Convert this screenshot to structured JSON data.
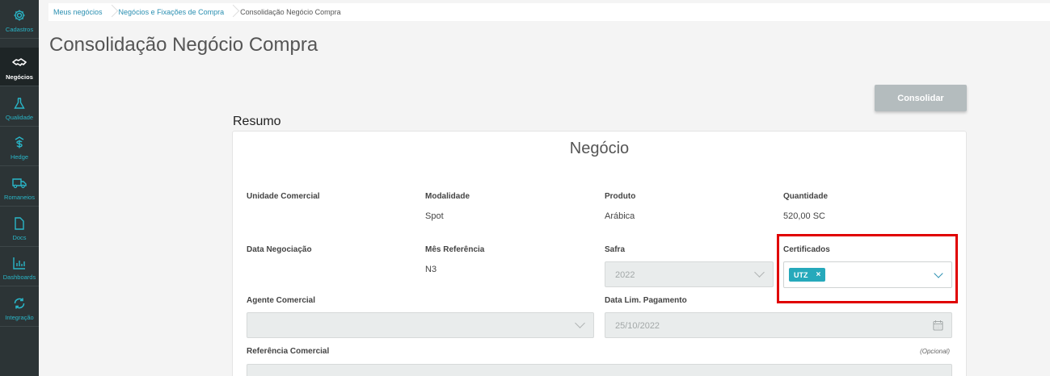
{
  "sidebar": {
    "items": [
      {
        "label": "Cadastros",
        "icon": "gear-icon"
      },
      {
        "label": "Negócios",
        "icon": "handshake-icon"
      },
      {
        "label": "Qualidade",
        "icon": "flask-icon"
      },
      {
        "label": "Hedge",
        "icon": "dollar-icon"
      },
      {
        "label": "Romaneios",
        "icon": "truck-icon"
      },
      {
        "label": "Docs",
        "icon": "document-icon"
      },
      {
        "label": "Dashboards",
        "icon": "bar-chart-icon"
      },
      {
        "label": "Integração",
        "icon": "sync-icon"
      }
    ],
    "active": "Negócios",
    "accent": "#29b6c8"
  },
  "breadcrumb": [
    "Meus negócios",
    "Negócios e Fixações de Compra",
    "Consolidação Negócio Compra"
  ],
  "page_title": "Consolidação Negócio Compra",
  "consolidar_label": "Consolidar",
  "resumo_title": "Resumo",
  "card": {
    "title": "Negócio",
    "unidade_comercial": {
      "label": "Unidade Comercial",
      "value": ""
    },
    "modalidade": {
      "label": "Modalidade",
      "value": "Spot"
    },
    "produto": {
      "label": "Produto",
      "value": "Arábica"
    },
    "quantidade": {
      "label": "Quantidade",
      "value": "520,00 SC"
    },
    "data_negociacao": {
      "label": "Data Negociação",
      "value": ""
    },
    "mes_referencia": {
      "label": "Mês Referência",
      "value": "N3"
    },
    "safra": {
      "label": "Safra",
      "value": "2022"
    },
    "certificados": {
      "label": "Certificados",
      "tags": [
        "UTZ"
      ]
    },
    "agente_comercial": {
      "label": "Agente Comercial",
      "value": ""
    },
    "data_lim_pagamento": {
      "label": "Data Lim. Pagamento",
      "value": "25/10/2022"
    },
    "referencia_comercial": {
      "label": "Referência Comercial",
      "optional": "(Opcional)"
    }
  },
  "colors": {
    "highlight": "#e00000",
    "chip": "#26a9bb",
    "button_disabled": "#b4bcbe"
  }
}
